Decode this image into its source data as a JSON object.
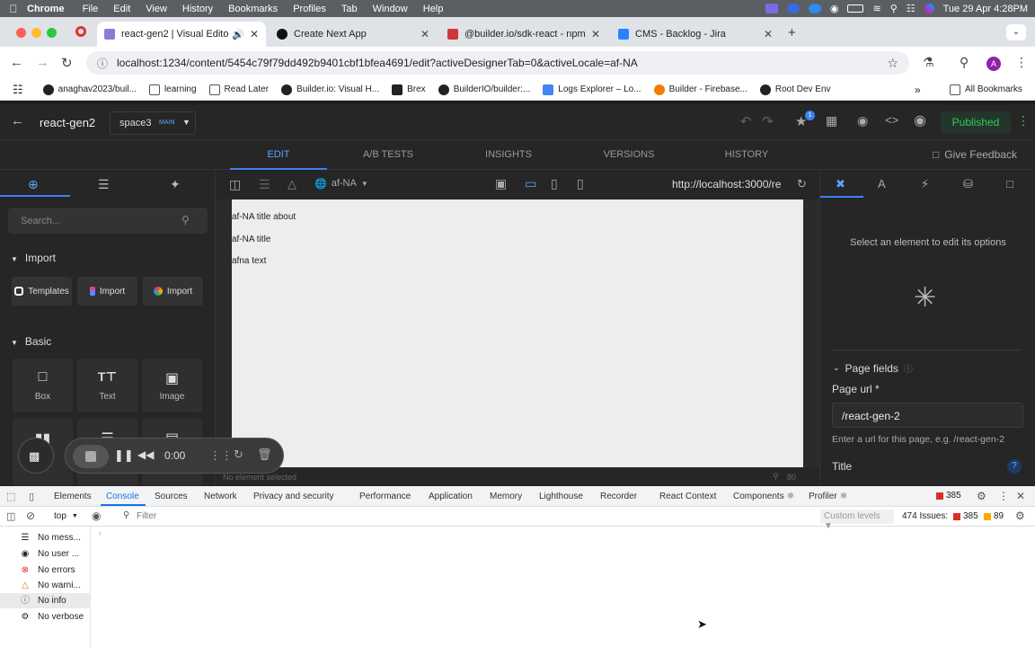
{
  "menubar": {
    "app": "Chrome",
    "items": [
      "File",
      "Edit",
      "View",
      "History",
      "Bookmarks",
      "Profiles",
      "Tab",
      "Window",
      "Help"
    ],
    "datetime": "Tue 29 Apr  4:28PM"
  },
  "tabs": [
    {
      "title": "react-gen2 | Visual Editor",
      "active": true
    },
    {
      "title": "Create Next App",
      "active": false
    },
    {
      "title": "@builder.io/sdk-react - npm",
      "active": false
    },
    {
      "title": "CMS - Backlog - Jira",
      "active": false
    }
  ],
  "address": {
    "url": "localhost:1234/content/5454c79f79dd492b9401cbf1bfea4691/edit?activeDesignerTab=0&activeLocale=af-NA"
  },
  "bookmarks": {
    "items": [
      "anaghav2023/buil...",
      "learning",
      "Read Later",
      "Builder.io: Visual H...",
      "Brex",
      "BuilderIO/builder:...",
      "Logs Explorer – Lo...",
      "Builder - Firebase...",
      "Root Dev Env"
    ],
    "all": "All Bookmarks"
  },
  "builder": {
    "page_name": "react-gen2",
    "space": "space3",
    "space_badge": "MAIN",
    "publish_status": "Published",
    "notif_count": "1",
    "mode_tabs": [
      "EDIT",
      "A/B TESTS",
      "INSIGHTS",
      "VERSIONS",
      "HISTORY"
    ],
    "feedback": "Give Feedback"
  },
  "left": {
    "search_placeholder": "Search...",
    "import_heading": "Import",
    "import_buttons": [
      "Templates",
      "Import",
      "Import"
    ],
    "basic_heading": "Basic",
    "blocks": [
      "Box",
      "Text",
      "Image"
    ]
  },
  "canvas": {
    "locale": "af-NA",
    "preview_url": "http://localhost:3000/re",
    "texts": [
      "af-NA title about",
      "af-NA title",
      "afna text"
    ],
    "status": "No element selected",
    "zoom": "80"
  },
  "right": {
    "hint": "Select an element to edit its options",
    "page_fields": "Page fields",
    "page_url_label": "Page url *",
    "page_url_value": "/react-gen-2",
    "page_url_help": "Enter a url for this page, e.g. /react-gen-2",
    "title_label": "Title"
  },
  "recorder": {
    "time": "0:00"
  },
  "devtools": {
    "tabs": [
      "Elements",
      "Console",
      "Sources",
      "Network",
      "Privacy and security",
      "Performance",
      "Application",
      "Memory",
      "Lighthouse",
      "Recorder",
      "React Context",
      "Components ⚛",
      "Profiler ⚛"
    ],
    "error_badge": "385",
    "context": "top",
    "filter_placeholder": "Filter",
    "levels": "Custom levels",
    "issues_label": "474 Issues:",
    "issues_errors": "385",
    "issues_warnings": "89",
    "sidebar": [
      "No mess...",
      "No user ...",
      "No errors",
      "No warni...",
      "No info",
      "No verbose"
    ]
  },
  "colors": {
    "accent": "#3b82f6",
    "published": "#22c55e",
    "bg_dark": "#262626"
  }
}
